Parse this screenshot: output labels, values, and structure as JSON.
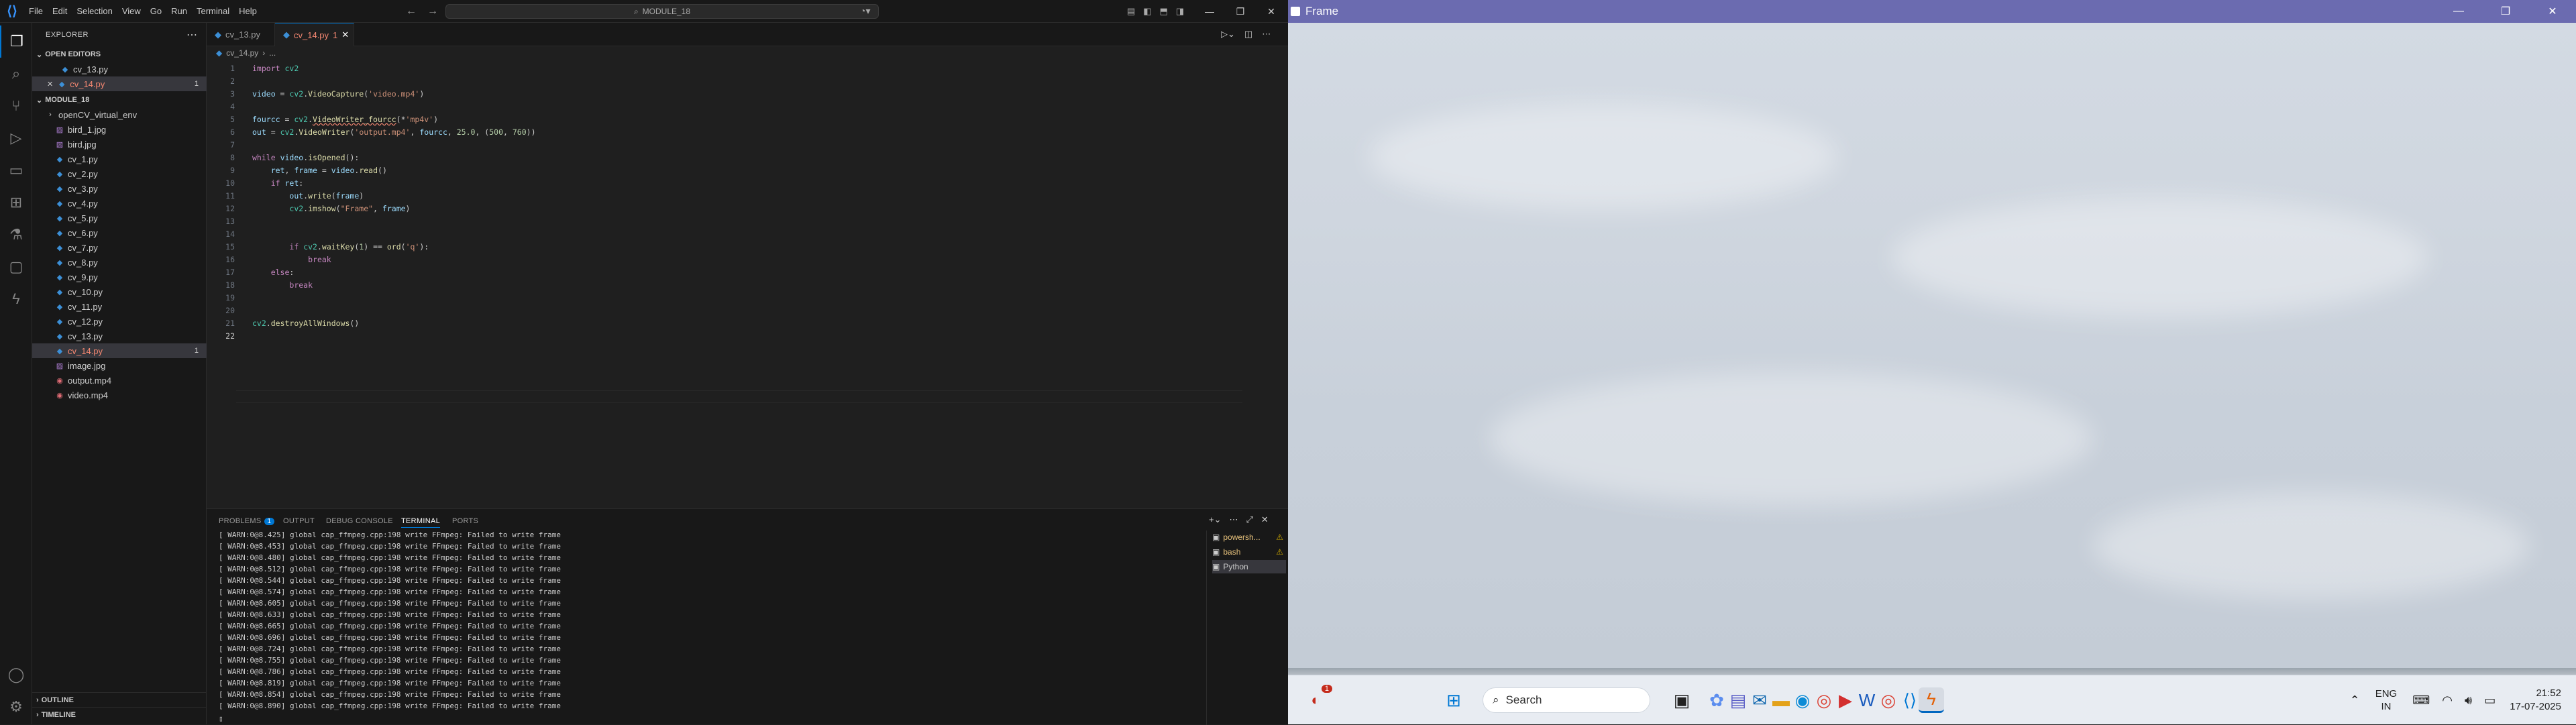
{
  "vscode": {
    "menu": [
      "File",
      "Edit",
      "Selection",
      "View",
      "Go",
      "Run",
      "Terminal",
      "Help"
    ],
    "command_center": "MODULE_18",
    "sidebar": {
      "title": "EXPLORER",
      "open_editors_label": "OPEN EDITORS",
      "open_editors": [
        {
          "name": "cv_13.py",
          "badge": ""
        },
        {
          "name": "cv_14.py",
          "badge": "1"
        }
      ],
      "folder_label": "MODULE_18",
      "files": [
        {
          "name": "openCV_virtual_env",
          "type": "folder",
          "badge": ""
        },
        {
          "name": "bird_1.jpg",
          "type": "jpg",
          "badge": ""
        },
        {
          "name": "bird.jpg",
          "type": "jpg",
          "badge": ""
        },
        {
          "name": "cv_1.py",
          "type": "py",
          "badge": ""
        },
        {
          "name": "cv_2.py",
          "type": "py",
          "badge": ""
        },
        {
          "name": "cv_3.py",
          "type": "py",
          "badge": ""
        },
        {
          "name": "cv_4.py",
          "type": "py",
          "badge": ""
        },
        {
          "name": "cv_5.py",
          "type": "py",
          "badge": ""
        },
        {
          "name": "cv_6.py",
          "type": "py",
          "badge": ""
        },
        {
          "name": "cv_7.py",
          "type": "py",
          "badge": ""
        },
        {
          "name": "cv_8.py",
          "type": "py",
          "badge": ""
        },
        {
          "name": "cv_9.py",
          "type": "py",
          "badge": ""
        },
        {
          "name": "cv_10.py",
          "type": "py",
          "badge": ""
        },
        {
          "name": "cv_11.py",
          "type": "py",
          "badge": ""
        },
        {
          "name": "cv_12.py",
          "type": "py",
          "badge": ""
        },
        {
          "name": "cv_13.py",
          "type": "py",
          "badge": ""
        },
        {
          "name": "cv_14.py",
          "type": "py",
          "badge": "1"
        },
        {
          "name": "image.jpg",
          "type": "jpg",
          "badge": ""
        },
        {
          "name": "output.mp4",
          "type": "mp4",
          "badge": ""
        },
        {
          "name": "video.mp4",
          "type": "mp4",
          "badge": ""
        }
      ],
      "outline_label": "OUTLINE",
      "timeline_label": "TIMELINE"
    },
    "tabs": [
      {
        "name": "cv_13.py",
        "badge": ""
      },
      {
        "name": "cv_14.py",
        "badge": "1"
      }
    ],
    "breadcrumb": [
      "cv_14.py",
      "..."
    ],
    "code_lines": [
      "1",
      "2",
      "3",
      "4",
      "5",
      "6",
      "7",
      "8",
      "9",
      "10",
      "11",
      "12",
      "13",
      "14",
      "15",
      "16",
      "17",
      "18",
      "19",
      "20",
      "21",
      "22"
    ],
    "panel": {
      "tabs": [
        "PROBLEMS",
        "OUTPUT",
        "DEBUG CONSOLE",
        "TERMINAL",
        "PORTS"
      ],
      "problems_count": "1",
      "terminal_lines": [
        "[ WARN:0@8.425] global cap_ffmpeg.cpp:198 write FFmpeg: Failed to write frame",
        "[ WARN:0@8.453] global cap_ffmpeg.cpp:198 write FFmpeg: Failed to write frame",
        "[ WARN:0@8.480] global cap_ffmpeg.cpp:198 write FFmpeg: Failed to write frame",
        "[ WARN:0@8.512] global cap_ffmpeg.cpp:198 write FFmpeg: Failed to write frame",
        "[ WARN:0@8.544] global cap_ffmpeg.cpp:198 write FFmpeg: Failed to write frame",
        "[ WARN:0@8.574] global cap_ffmpeg.cpp:198 write FFmpeg: Failed to write frame",
        "[ WARN:0@8.605] global cap_ffmpeg.cpp:198 write FFmpeg: Failed to write frame",
        "[ WARN:0@8.633] global cap_ffmpeg.cpp:198 write FFmpeg: Failed to write frame",
        "[ WARN:0@8.665] global cap_ffmpeg.cpp:198 write FFmpeg: Failed to write frame",
        "[ WARN:0@8.696] global cap_ffmpeg.cpp:198 write FFmpeg: Failed to write frame",
        "[ WARN:0@8.724] global cap_ffmpeg.cpp:198 write FFmpeg: Failed to write frame",
        "[ WARN:0@8.755] global cap_ffmpeg.cpp:198 write FFmpeg: Failed to write frame",
        "[ WARN:0@8.786] global cap_ffmpeg.cpp:198 write FFmpeg: Failed to write frame",
        "[ WARN:0@8.819] global cap_ffmpeg.cpp:198 write FFmpeg: Failed to write frame",
        "[ WARN:0@8.854] global cap_ffmpeg.cpp:198 write FFmpeg: Failed to write frame",
        "[ WARN:0@8.890] global cap_ffmpeg.cpp:198 write FFmpeg: Failed to write frame"
      ],
      "terminal_instances": [
        {
          "name": "powersh...",
          "warn": "⚠"
        },
        {
          "name": "bash",
          "warn": "⚠"
        },
        {
          "name": "Python",
          "warn": ""
        }
      ]
    }
  },
  "frame_window": {
    "title": "Frame"
  },
  "taskbar": {
    "search_placeholder": "Search",
    "notification_count": "1",
    "lang_top": "ENG",
    "lang_bottom": "IN",
    "time": "21:52",
    "date": "17-07-2025"
  },
  "colors": {
    "accent": "#0078d4",
    "frame_titlebar": "#6b6bb0",
    "error": "#f48771"
  }
}
